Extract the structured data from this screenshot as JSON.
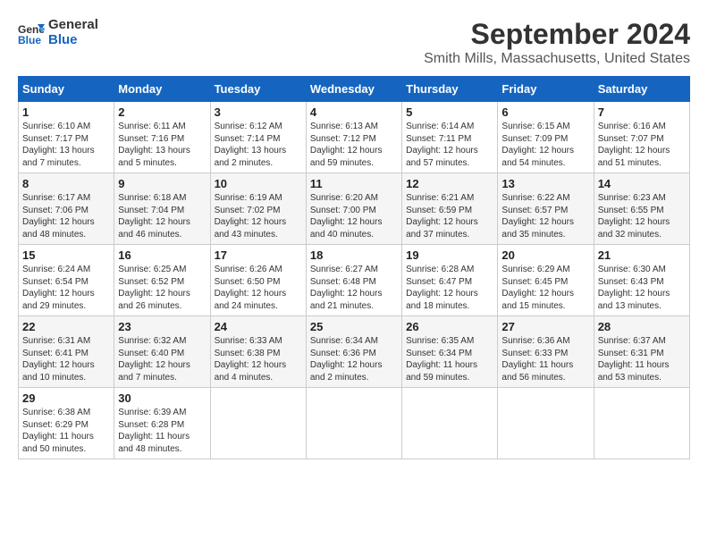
{
  "header": {
    "logo_line1": "General",
    "logo_line2": "Blue",
    "month_title": "September 2024",
    "location": "Smith Mills, Massachusetts, United States"
  },
  "weekdays": [
    "Sunday",
    "Monday",
    "Tuesday",
    "Wednesday",
    "Thursday",
    "Friday",
    "Saturday"
  ],
  "weeks": [
    [
      {
        "day": "1",
        "sunrise": "Sunrise: 6:10 AM",
        "sunset": "Sunset: 7:17 PM",
        "daylight": "Daylight: 13 hours and 7 minutes."
      },
      {
        "day": "2",
        "sunrise": "Sunrise: 6:11 AM",
        "sunset": "Sunset: 7:16 PM",
        "daylight": "Daylight: 13 hours and 5 minutes."
      },
      {
        "day": "3",
        "sunrise": "Sunrise: 6:12 AM",
        "sunset": "Sunset: 7:14 PM",
        "daylight": "Daylight: 13 hours and 2 minutes."
      },
      {
        "day": "4",
        "sunrise": "Sunrise: 6:13 AM",
        "sunset": "Sunset: 7:12 PM",
        "daylight": "Daylight: 12 hours and 59 minutes."
      },
      {
        "day": "5",
        "sunrise": "Sunrise: 6:14 AM",
        "sunset": "Sunset: 7:11 PM",
        "daylight": "Daylight: 12 hours and 57 minutes."
      },
      {
        "day": "6",
        "sunrise": "Sunrise: 6:15 AM",
        "sunset": "Sunset: 7:09 PM",
        "daylight": "Daylight: 12 hours and 54 minutes."
      },
      {
        "day": "7",
        "sunrise": "Sunrise: 6:16 AM",
        "sunset": "Sunset: 7:07 PM",
        "daylight": "Daylight: 12 hours and 51 minutes."
      }
    ],
    [
      {
        "day": "8",
        "sunrise": "Sunrise: 6:17 AM",
        "sunset": "Sunset: 7:06 PM",
        "daylight": "Daylight: 12 hours and 48 minutes."
      },
      {
        "day": "9",
        "sunrise": "Sunrise: 6:18 AM",
        "sunset": "Sunset: 7:04 PM",
        "daylight": "Daylight: 12 hours and 46 minutes."
      },
      {
        "day": "10",
        "sunrise": "Sunrise: 6:19 AM",
        "sunset": "Sunset: 7:02 PM",
        "daylight": "Daylight: 12 hours and 43 minutes."
      },
      {
        "day": "11",
        "sunrise": "Sunrise: 6:20 AM",
        "sunset": "Sunset: 7:00 PM",
        "daylight": "Daylight: 12 hours and 40 minutes."
      },
      {
        "day": "12",
        "sunrise": "Sunrise: 6:21 AM",
        "sunset": "Sunset: 6:59 PM",
        "daylight": "Daylight: 12 hours and 37 minutes."
      },
      {
        "day": "13",
        "sunrise": "Sunrise: 6:22 AM",
        "sunset": "Sunset: 6:57 PM",
        "daylight": "Daylight: 12 hours and 35 minutes."
      },
      {
        "day": "14",
        "sunrise": "Sunrise: 6:23 AM",
        "sunset": "Sunset: 6:55 PM",
        "daylight": "Daylight: 12 hours and 32 minutes."
      }
    ],
    [
      {
        "day": "15",
        "sunrise": "Sunrise: 6:24 AM",
        "sunset": "Sunset: 6:54 PM",
        "daylight": "Daylight: 12 hours and 29 minutes."
      },
      {
        "day": "16",
        "sunrise": "Sunrise: 6:25 AM",
        "sunset": "Sunset: 6:52 PM",
        "daylight": "Daylight: 12 hours and 26 minutes."
      },
      {
        "day": "17",
        "sunrise": "Sunrise: 6:26 AM",
        "sunset": "Sunset: 6:50 PM",
        "daylight": "Daylight: 12 hours and 24 minutes."
      },
      {
        "day": "18",
        "sunrise": "Sunrise: 6:27 AM",
        "sunset": "Sunset: 6:48 PM",
        "daylight": "Daylight: 12 hours and 21 minutes."
      },
      {
        "day": "19",
        "sunrise": "Sunrise: 6:28 AM",
        "sunset": "Sunset: 6:47 PM",
        "daylight": "Daylight: 12 hours and 18 minutes."
      },
      {
        "day": "20",
        "sunrise": "Sunrise: 6:29 AM",
        "sunset": "Sunset: 6:45 PM",
        "daylight": "Daylight: 12 hours and 15 minutes."
      },
      {
        "day": "21",
        "sunrise": "Sunrise: 6:30 AM",
        "sunset": "Sunset: 6:43 PM",
        "daylight": "Daylight: 12 hours and 13 minutes."
      }
    ],
    [
      {
        "day": "22",
        "sunrise": "Sunrise: 6:31 AM",
        "sunset": "Sunset: 6:41 PM",
        "daylight": "Daylight: 12 hours and 10 minutes."
      },
      {
        "day": "23",
        "sunrise": "Sunrise: 6:32 AM",
        "sunset": "Sunset: 6:40 PM",
        "daylight": "Daylight: 12 hours and 7 minutes."
      },
      {
        "day": "24",
        "sunrise": "Sunrise: 6:33 AM",
        "sunset": "Sunset: 6:38 PM",
        "daylight": "Daylight: 12 hours and 4 minutes."
      },
      {
        "day": "25",
        "sunrise": "Sunrise: 6:34 AM",
        "sunset": "Sunset: 6:36 PM",
        "daylight": "Daylight: 12 hours and 2 minutes."
      },
      {
        "day": "26",
        "sunrise": "Sunrise: 6:35 AM",
        "sunset": "Sunset: 6:34 PM",
        "daylight": "Daylight: 11 hours and 59 minutes."
      },
      {
        "day": "27",
        "sunrise": "Sunrise: 6:36 AM",
        "sunset": "Sunset: 6:33 PM",
        "daylight": "Daylight: 11 hours and 56 minutes."
      },
      {
        "day": "28",
        "sunrise": "Sunrise: 6:37 AM",
        "sunset": "Sunset: 6:31 PM",
        "daylight": "Daylight: 11 hours and 53 minutes."
      }
    ],
    [
      {
        "day": "29",
        "sunrise": "Sunrise: 6:38 AM",
        "sunset": "Sunset: 6:29 PM",
        "daylight": "Daylight: 11 hours and 50 minutes."
      },
      {
        "day": "30",
        "sunrise": "Sunrise: 6:39 AM",
        "sunset": "Sunset: 6:28 PM",
        "daylight": "Daylight: 11 hours and 48 minutes."
      },
      null,
      null,
      null,
      null,
      null
    ]
  ]
}
